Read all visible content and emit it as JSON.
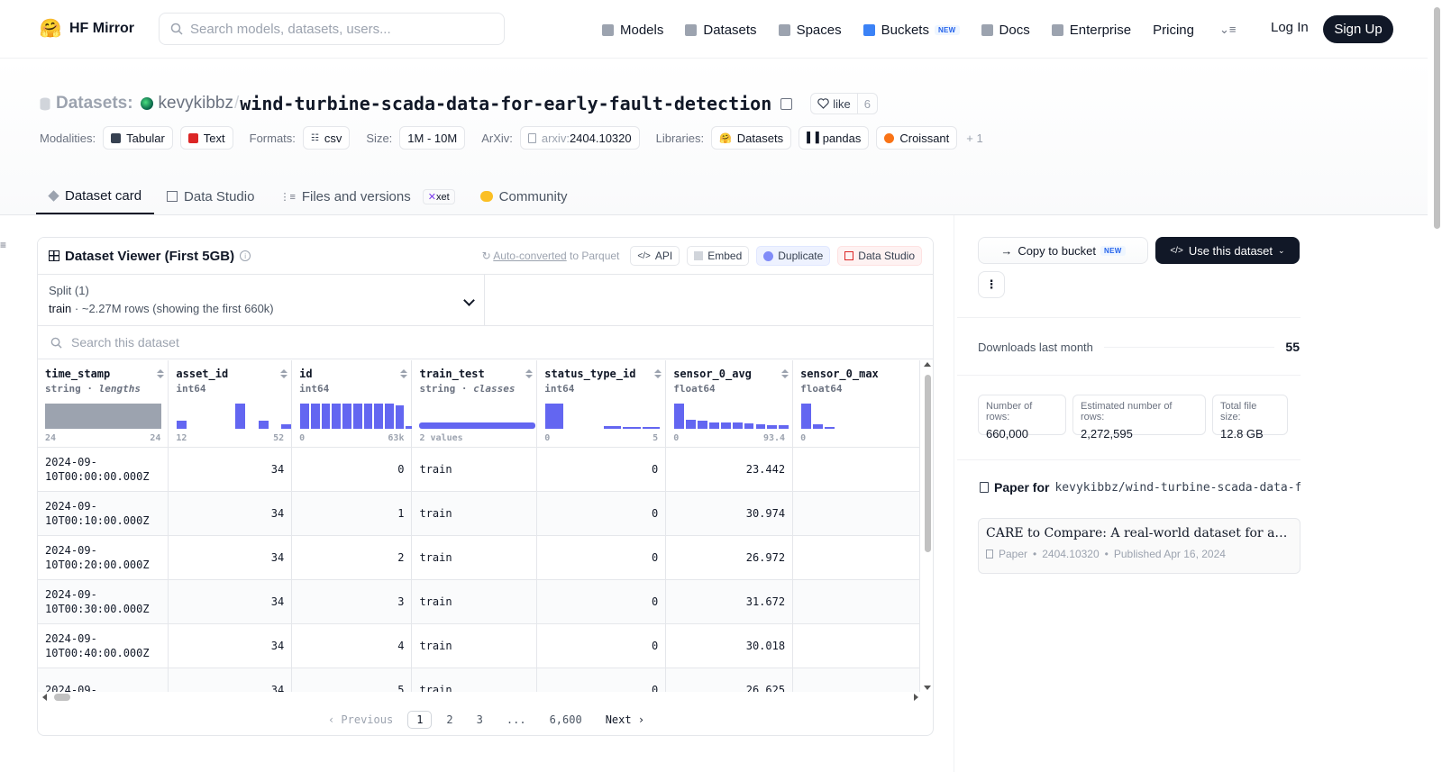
{
  "nav": {
    "logo": "HF Mirror",
    "search_placeholder": "Search models, datasets, users...",
    "links": [
      {
        "label": "Models",
        "icon": "cube-icon",
        "color": "#9ca3af"
      },
      {
        "label": "Datasets",
        "icon": "database-icon",
        "color": "#9ca3af"
      },
      {
        "label": "Spaces",
        "icon": "grid-icon",
        "color": "#9ca3af"
      },
      {
        "label": "Buckets",
        "icon": "bucket-icon",
        "color": "#3b82f6",
        "badge": "NEW"
      },
      {
        "label": "Docs",
        "icon": "book-icon",
        "color": "#9ca3af"
      },
      {
        "label": "Enterprise",
        "icon": "enterprise-icon",
        "color": "#9ca3af"
      },
      {
        "label": "Pricing"
      }
    ],
    "login": "Log In",
    "signup": "Sign Up"
  },
  "header": {
    "type_label": "Datasets:",
    "owner": "kevykibbz",
    "name": "wind-turbine-scada-data-for-early-fault-detection",
    "like_label": "like",
    "like_count": "6",
    "meta": {
      "modalities_label": "Modalities:",
      "modalities": [
        "Tabular",
        "Text"
      ],
      "formats_label": "Formats:",
      "format": "csv",
      "size_label": "Size:",
      "size": "1M - 10M",
      "arxiv_label": "ArXiv:",
      "arxiv_prefix": "arxiv:",
      "arxiv": "2404.10320",
      "libraries_label": "Libraries:",
      "libraries": [
        "Datasets",
        "pandas",
        "Croissant"
      ],
      "more": "+ 1"
    },
    "tabs": [
      "Dataset card",
      "Data Studio",
      "Files and versions",
      "Community"
    ],
    "xet": "xet"
  },
  "viewer": {
    "title": "Dataset Viewer (First 5GB)",
    "auto_link": "Auto-converted",
    "auto_rest": " to Parquet",
    "api": "API",
    "embed": "Embed",
    "duplicate": "Duplicate",
    "data_studio": "Data Studio",
    "split_label": "Split (1)",
    "split_name": "train",
    "split_info": " · ~2.27M rows (showing the first 660k)",
    "search_placeholder": "Search this dataset",
    "columns": [
      {
        "name": "time_stamp",
        "type": "string",
        "kind": "lengths",
        "min": "24",
        "max": "24"
      },
      {
        "name": "asset_id",
        "type": "int64",
        "min": "12",
        "max": "52"
      },
      {
        "name": "id",
        "type": "int64",
        "min": "0",
        "max": "63k"
      },
      {
        "name": "train_test",
        "type": "string",
        "kind": "classes",
        "min": "2 values",
        "max": ""
      },
      {
        "name": "status_type_id",
        "type": "int64",
        "min": "0",
        "max": "5"
      },
      {
        "name": "sensor_0_avg",
        "type": "float64",
        "min": "0",
        "max": "93.4"
      },
      {
        "name": "sensor_0_max",
        "type": "float64",
        "min": "0",
        "max": ""
      }
    ],
    "histograms": {
      "asset_id": [
        0.3,
        0,
        0,
        0,
        0,
        1,
        0,
        0.3,
        0,
        0.15
      ],
      "id": [
        1,
        1,
        1,
        1,
        1,
        1,
        1,
        1,
        1,
        0.9,
        0.1
      ],
      "status_type_id": [
        1,
        0,
        0,
        0.08,
        0.06,
        0.05
      ],
      "sensor_0_avg": [
        1,
        0.35,
        0.3,
        0.25,
        0.25,
        0.22,
        0.18,
        0.15,
        0.12,
        0.12
      ],
      "sensor_0_max": [
        1,
        0.15,
        0.07
      ]
    },
    "rows": [
      {
        "time_stamp": "2024-09-10T00:00:00.000Z",
        "asset_id": "34",
        "id": "0",
        "train_test": "train",
        "status_type_id": "0",
        "sensor_0_avg": "23.442"
      },
      {
        "time_stamp": "2024-09-10T00:10:00.000Z",
        "asset_id": "34",
        "id": "1",
        "train_test": "train",
        "status_type_id": "0",
        "sensor_0_avg": "30.974"
      },
      {
        "time_stamp": "2024-09-10T00:20:00.000Z",
        "asset_id": "34",
        "id": "2",
        "train_test": "train",
        "status_type_id": "0",
        "sensor_0_avg": "26.972"
      },
      {
        "time_stamp": "2024-09-10T00:30:00.000Z",
        "asset_id": "34",
        "id": "3",
        "train_test": "train",
        "status_type_id": "0",
        "sensor_0_avg": "31.672"
      },
      {
        "time_stamp": "2024-09-10T00:40:00.000Z",
        "asset_id": "34",
        "id": "4",
        "train_test": "train",
        "status_type_id": "0",
        "sensor_0_avg": "30.018"
      },
      {
        "time_stamp": "2024-09-",
        "asset_id": "34",
        "id": "5",
        "train_test": "train",
        "status_type_id": "0",
        "sensor_0_avg": "26.625"
      }
    ],
    "pager": {
      "prev": "Previous",
      "pages": [
        "1",
        "2",
        "3",
        "...",
        "6,600"
      ],
      "next": "Next"
    }
  },
  "sidebar": {
    "copy_bucket": "Copy to bucket",
    "new": "NEW",
    "use_dataset": "Use this dataset",
    "downloads_label": "Downloads last month",
    "downloads": "55",
    "stats": [
      {
        "label": "Number of rows:",
        "value": "660,000"
      },
      {
        "label": "Estimated number of rows:",
        "value": "2,272,595"
      },
      {
        "label": "Total file size:",
        "value": "12.8 GB"
      }
    ],
    "paper_for": "Paper for",
    "paper_repo": "kevykibbz/wind-turbine-scada-data-for-early-fault-detection",
    "paper_title": "CARE to Compare: A real-world dataset for anomaly detection in wind turbine data",
    "paper_kind": "Paper",
    "paper_id": "2404.10320",
    "paper_published": "Published Apr 16, 2024"
  }
}
